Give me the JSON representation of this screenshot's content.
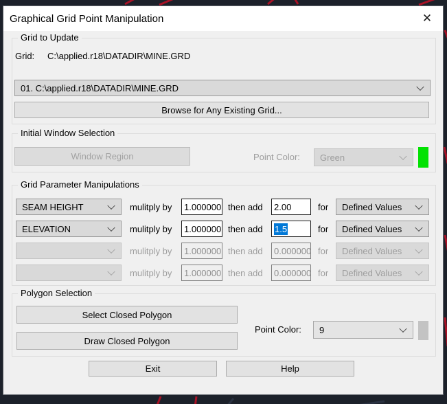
{
  "window": {
    "title": "Graphical Grid Point Manipulation",
    "close_glyph": "✕"
  },
  "grid_to_update": {
    "legend": "Grid to Update",
    "grid_label": "Grid:",
    "grid_path": "C:\\applied.r18\\DATADIR\\MINE.GRD",
    "grid_select_value": "01. C:\\applied.r18\\DATADIR\\MINE.GRD",
    "browse_button": "Browse for Any Existing Grid..."
  },
  "initial_window_selection": {
    "legend": "Initial Window Selection",
    "window_region_button": "Window Region",
    "point_color_label": "Point Color:",
    "point_color_value": "Green",
    "swatch_color": "#02e202"
  },
  "grid_parameter_manipulations": {
    "legend": "Grid Parameter Manipulations",
    "rows": [
      {
        "parameter": "SEAM HEIGHT",
        "multiply_label": "mulitply by",
        "multiply_value": "1.000000",
        "add_label": "then add",
        "add_value": "2.00",
        "for_label": "for",
        "apply_to": "Defined Values"
      },
      {
        "parameter": "ELEVATION",
        "multiply_label": "mulitply by",
        "multiply_value": "1.000000",
        "add_label": "then add",
        "add_value": "1.5",
        "for_label": "for",
        "apply_to": "Defined Values"
      },
      {
        "parameter": "",
        "multiply_label": "mulitply by",
        "multiply_value": "1.000000",
        "add_label": "then add",
        "add_value": "0.000000",
        "for_label": "for",
        "apply_to": "Defined Values"
      },
      {
        "parameter": "",
        "multiply_label": "mulitply by",
        "multiply_value": "1.000000",
        "add_label": "then add",
        "add_value": "0.000000",
        "for_label": "for",
        "apply_to": "Defined Values"
      }
    ]
  },
  "polygon_selection": {
    "legend": "Polygon Selection",
    "select_button": "Select Closed Polygon",
    "draw_button": "Draw Closed Polygon",
    "point_color_label": "Point Color:",
    "point_color_value": "9",
    "swatch_color": "#c3c3c3"
  },
  "footer": {
    "exit_button": "Exit",
    "help_button": "Help"
  },
  "colors": {
    "selection_highlight": "#0078d7",
    "background": "#1c212a",
    "accent_red_lines": "#b01228"
  }
}
